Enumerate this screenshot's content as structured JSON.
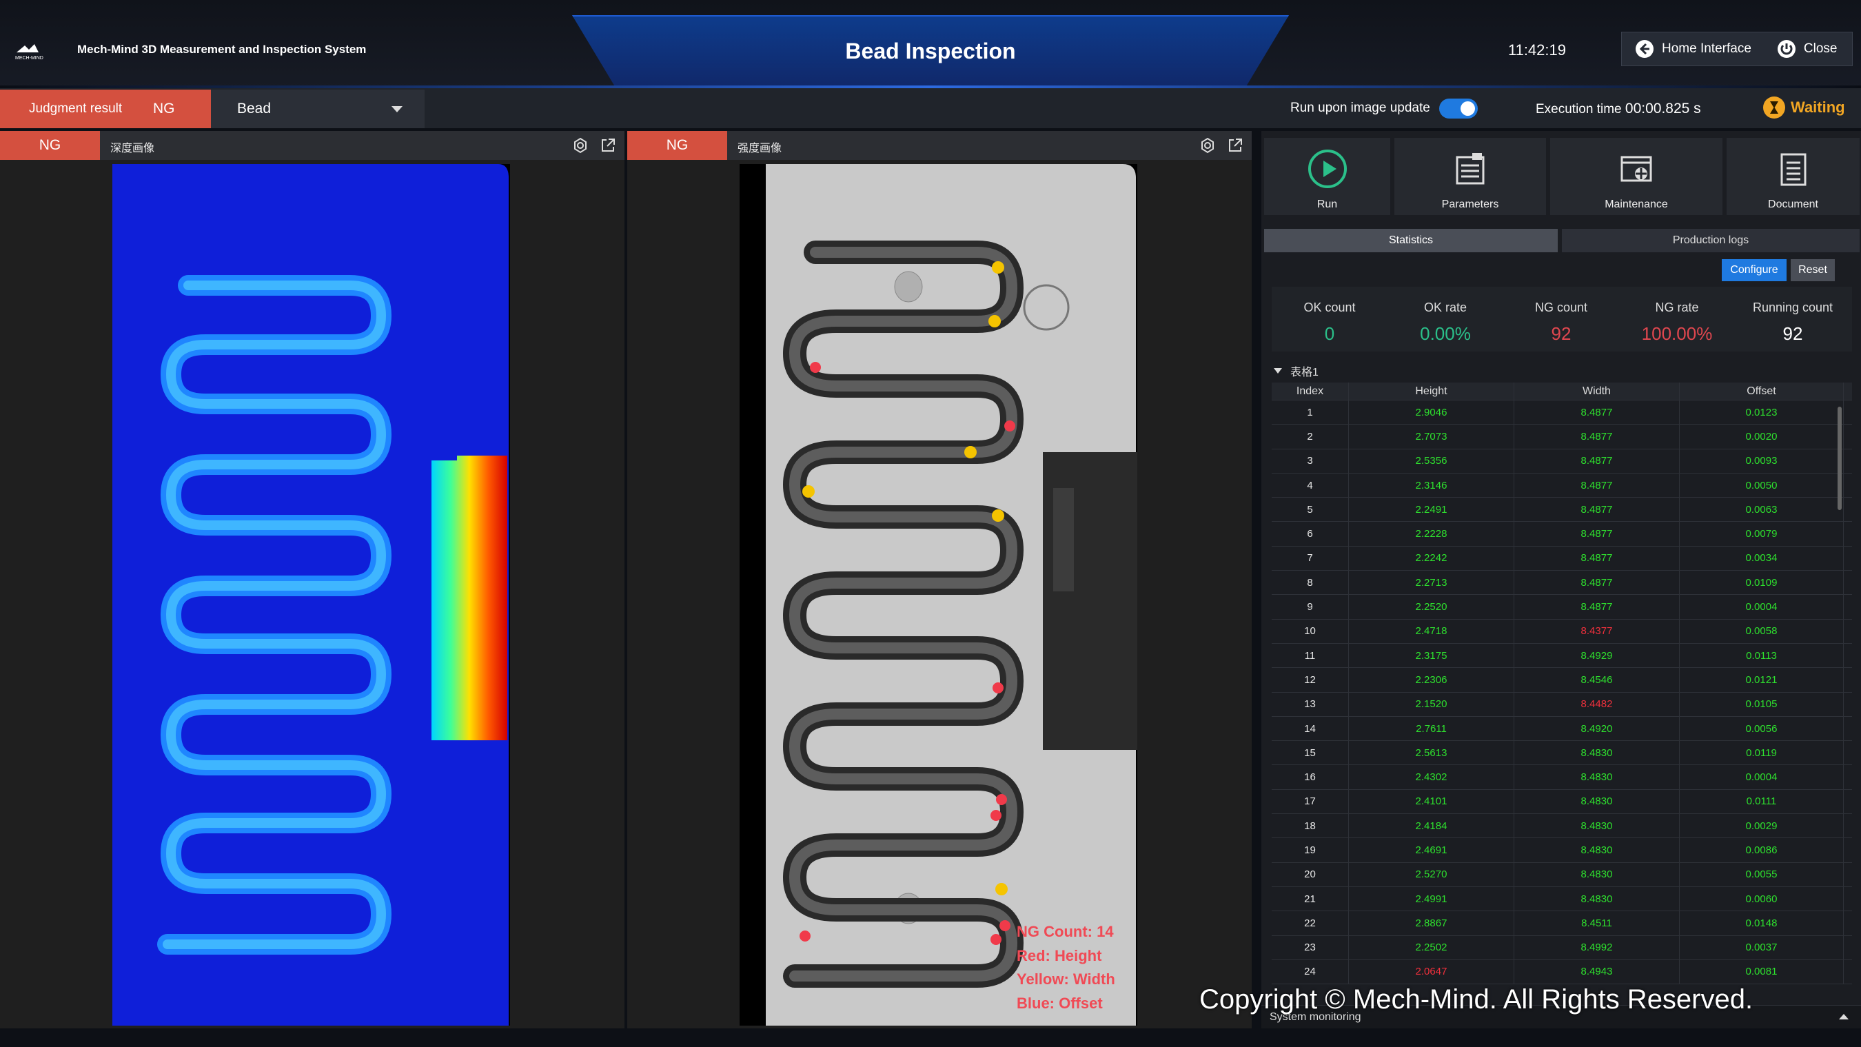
{
  "header": {
    "system_name": "Mech-Mind 3D Measurement and Inspection System",
    "logo_text": "MECH-MIND",
    "title": "Bead Inspection",
    "time": "11:42:19",
    "home_label": "Home Interface",
    "close_label": "Close"
  },
  "status": {
    "judgment_label": "Judgment result",
    "judgment_value": "NG",
    "selector_value": "Bead",
    "run_upon_update_label": "Run upon image update",
    "run_upon_update_on": true,
    "exec_label": "Execution time",
    "exec_value": "00:00.825 s",
    "state": "Waiting"
  },
  "panels": [
    {
      "tag": "NG",
      "title": "深度画像"
    },
    {
      "tag": "NG",
      "title": "强度画像"
    }
  ],
  "overlay_legend": {
    "ng_count": "NG Count: 14",
    "red": "Red: Height",
    "yellow": "Yellow: Width",
    "blue": "Blue: Offset"
  },
  "toolbar": [
    {
      "label": "Run",
      "icon": "run-icon"
    },
    {
      "label": "Parameters",
      "icon": "parameters-icon"
    },
    {
      "label": "Maintenance",
      "icon": "maintenance-icon"
    },
    {
      "label": "Document",
      "icon": "document-icon"
    }
  ],
  "tabs": {
    "statistics": "Statistics",
    "production_logs": "Production logs",
    "active": "Statistics"
  },
  "buttons": {
    "configure": "Configure",
    "reset": "Reset"
  },
  "stats": [
    {
      "label": "OK count",
      "value": "0",
      "color": "#2bc08a"
    },
    {
      "label": "OK rate",
      "value": "0.00%",
      "color": "#2bc08a"
    },
    {
      "label": "NG count",
      "value": "92",
      "color": "#e0474f"
    },
    {
      "label": "NG rate",
      "value": "100.00%",
      "color": "#e0474f"
    },
    {
      "label": "Running count",
      "value": "92",
      "color": "#ffffff"
    }
  ],
  "table": {
    "label": "表格1",
    "columns": [
      "Index",
      "Height",
      "Width",
      "Offset"
    ],
    "rows": [
      [
        "1",
        "2.9046",
        "8.4877",
        "0.0123"
      ],
      [
        "2",
        "2.7073",
        "8.4877",
        "0.0020"
      ],
      [
        "3",
        "2.5356",
        "8.4877",
        "0.0093"
      ],
      [
        "4",
        "2.3146",
        "8.4877",
        "0.0050"
      ],
      [
        "5",
        "2.2491",
        "8.4877",
        "0.0063"
      ],
      [
        "6",
        "2.2228",
        "8.4877",
        "0.0079"
      ],
      [
        "7",
        "2.2242",
        "8.4877",
        "0.0034"
      ],
      [
        "8",
        "2.2713",
        "8.4877",
        "0.0109"
      ],
      [
        "9",
        "2.2520",
        "8.4877",
        "0.0004"
      ],
      [
        "10",
        "2.4718",
        "8.4377",
        "0.0058"
      ],
      [
        "11",
        "2.3175",
        "8.4929",
        "0.0113"
      ],
      [
        "12",
        "2.2306",
        "8.4546",
        "0.0121"
      ],
      [
        "13",
        "2.1520",
        "8.4482",
        "0.0105"
      ],
      [
        "14",
        "2.7611",
        "8.4920",
        "0.0056"
      ],
      [
        "15",
        "2.5613",
        "8.4830",
        "0.0119"
      ],
      [
        "16",
        "2.4302",
        "8.4830",
        "0.0004"
      ],
      [
        "17",
        "2.4101",
        "8.4830",
        "0.0111"
      ],
      [
        "18",
        "2.4184",
        "8.4830",
        "0.0029"
      ],
      [
        "19",
        "2.4691",
        "8.4830",
        "0.0086"
      ],
      [
        "20",
        "2.5270",
        "8.4830",
        "0.0055"
      ],
      [
        "21",
        "2.4991",
        "8.4830",
        "0.0060"
      ],
      [
        "22",
        "2.8867",
        "8.4511",
        "0.0148"
      ],
      [
        "23",
        "2.2502",
        "8.4992",
        "0.0037"
      ],
      [
        "24",
        "2.0647",
        "8.4943",
        "0.0081"
      ]
    ],
    "ng_cells": [
      [
        10,
        2
      ],
      [
        13,
        2
      ],
      [
        24,
        1
      ]
    ],
    "ok_color": "#2ee02e",
    "ng_color": "#f0303c"
  },
  "system_monitoring": "System monitoring",
  "copyright": "Copyright © Mech-Mind. All Rights Reserved."
}
